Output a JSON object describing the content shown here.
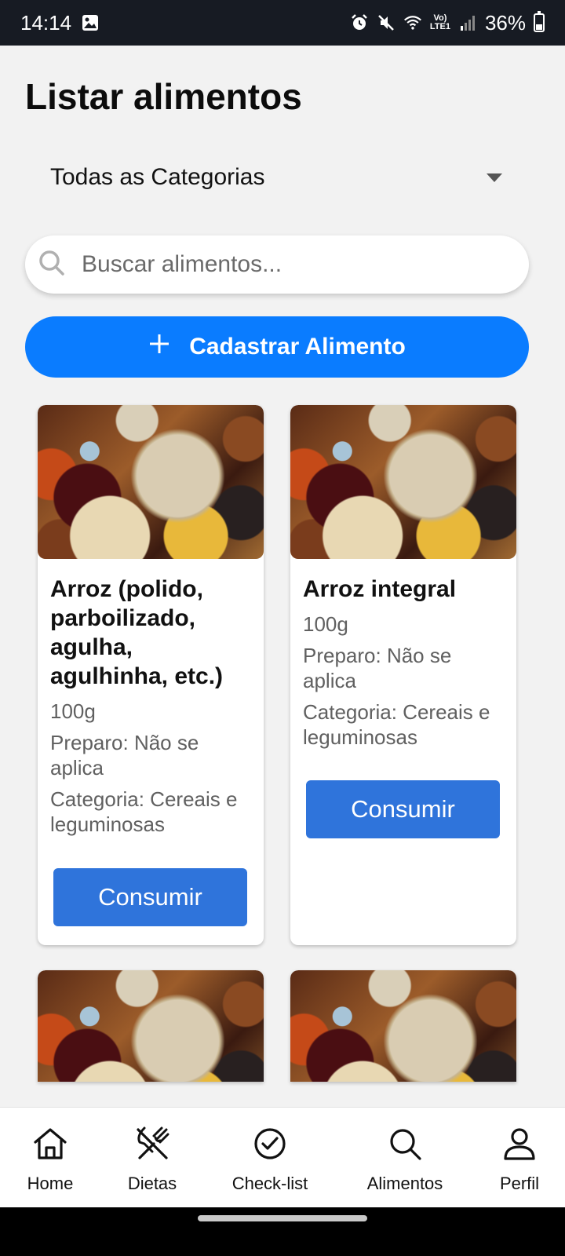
{
  "status_bar": {
    "time": "14:14",
    "network_label_top": "Vo)",
    "network_label_bottom": "LTE1",
    "battery": "36%",
    "battery_level": 0.36,
    "icons": [
      "gallery-icon",
      "alarm-icon",
      "mute-icon",
      "wifi-icon",
      "signal-icon",
      "battery-icon"
    ]
  },
  "header": {
    "title": "Listar alimentos"
  },
  "filter": {
    "category_selected": "Todas as Categorias"
  },
  "search": {
    "placeholder": "Buscar alimentos...",
    "value": ""
  },
  "add_button": {
    "label": "Cadastrar Alimento"
  },
  "foods": [
    {
      "name": "Arroz (polido, parboilizado, agulha, agulhinha, etc.)",
      "portion": "100g",
      "preparo": "Preparo: Não se aplica",
      "categoria": "Categoria: Cereais e leguminosas",
      "button": "Consumir"
    },
    {
      "name": "Arroz integral",
      "portion": "100g",
      "preparo": "Preparo: Não se aplica",
      "categoria": "Categoria: Cereais e leguminosas",
      "button": "Consumir"
    }
  ],
  "bottom_nav": {
    "items": [
      {
        "label": "Home",
        "icon": "home-icon"
      },
      {
        "label": "Dietas",
        "icon": "utensils-icon"
      },
      {
        "label": "Check-list",
        "icon": "check-circle-icon"
      },
      {
        "label": "Alimentos",
        "icon": "search-icon"
      },
      {
        "label": "Perfil",
        "icon": "user-icon"
      }
    ]
  },
  "colors": {
    "primary": "#0a7cff",
    "consume_button": "#2f74db",
    "status_bar": "#171b23",
    "background": "#f2f2f2"
  }
}
